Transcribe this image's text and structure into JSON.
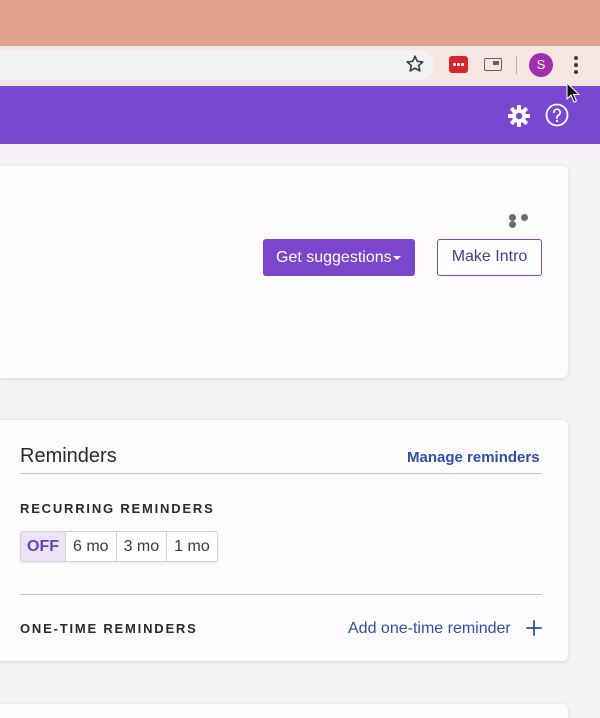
{
  "browser": {
    "avatar_letter": "S",
    "icons": [
      "star-icon",
      "extension-red-icon",
      "cast-icon",
      "chrome-menu-icon"
    ]
  },
  "header": {
    "accent_color": "#7848d0",
    "icons": [
      "gear-icon",
      "help-icon"
    ]
  },
  "intro_card": {
    "get_suggestions_label": "Get suggestions",
    "make_intro_label": "Make Intro"
  },
  "reminders": {
    "title": "Reminders",
    "manage_label": "Manage reminders",
    "recurring_label": "RECURRING REMINDERS",
    "options": [
      "OFF",
      "6 mo",
      "3 mo",
      "1 mo"
    ],
    "selected": "OFF",
    "one_time_label": "ONE-TIME REMINDERS",
    "add_one_time_label": "Add one-time reminder"
  }
}
